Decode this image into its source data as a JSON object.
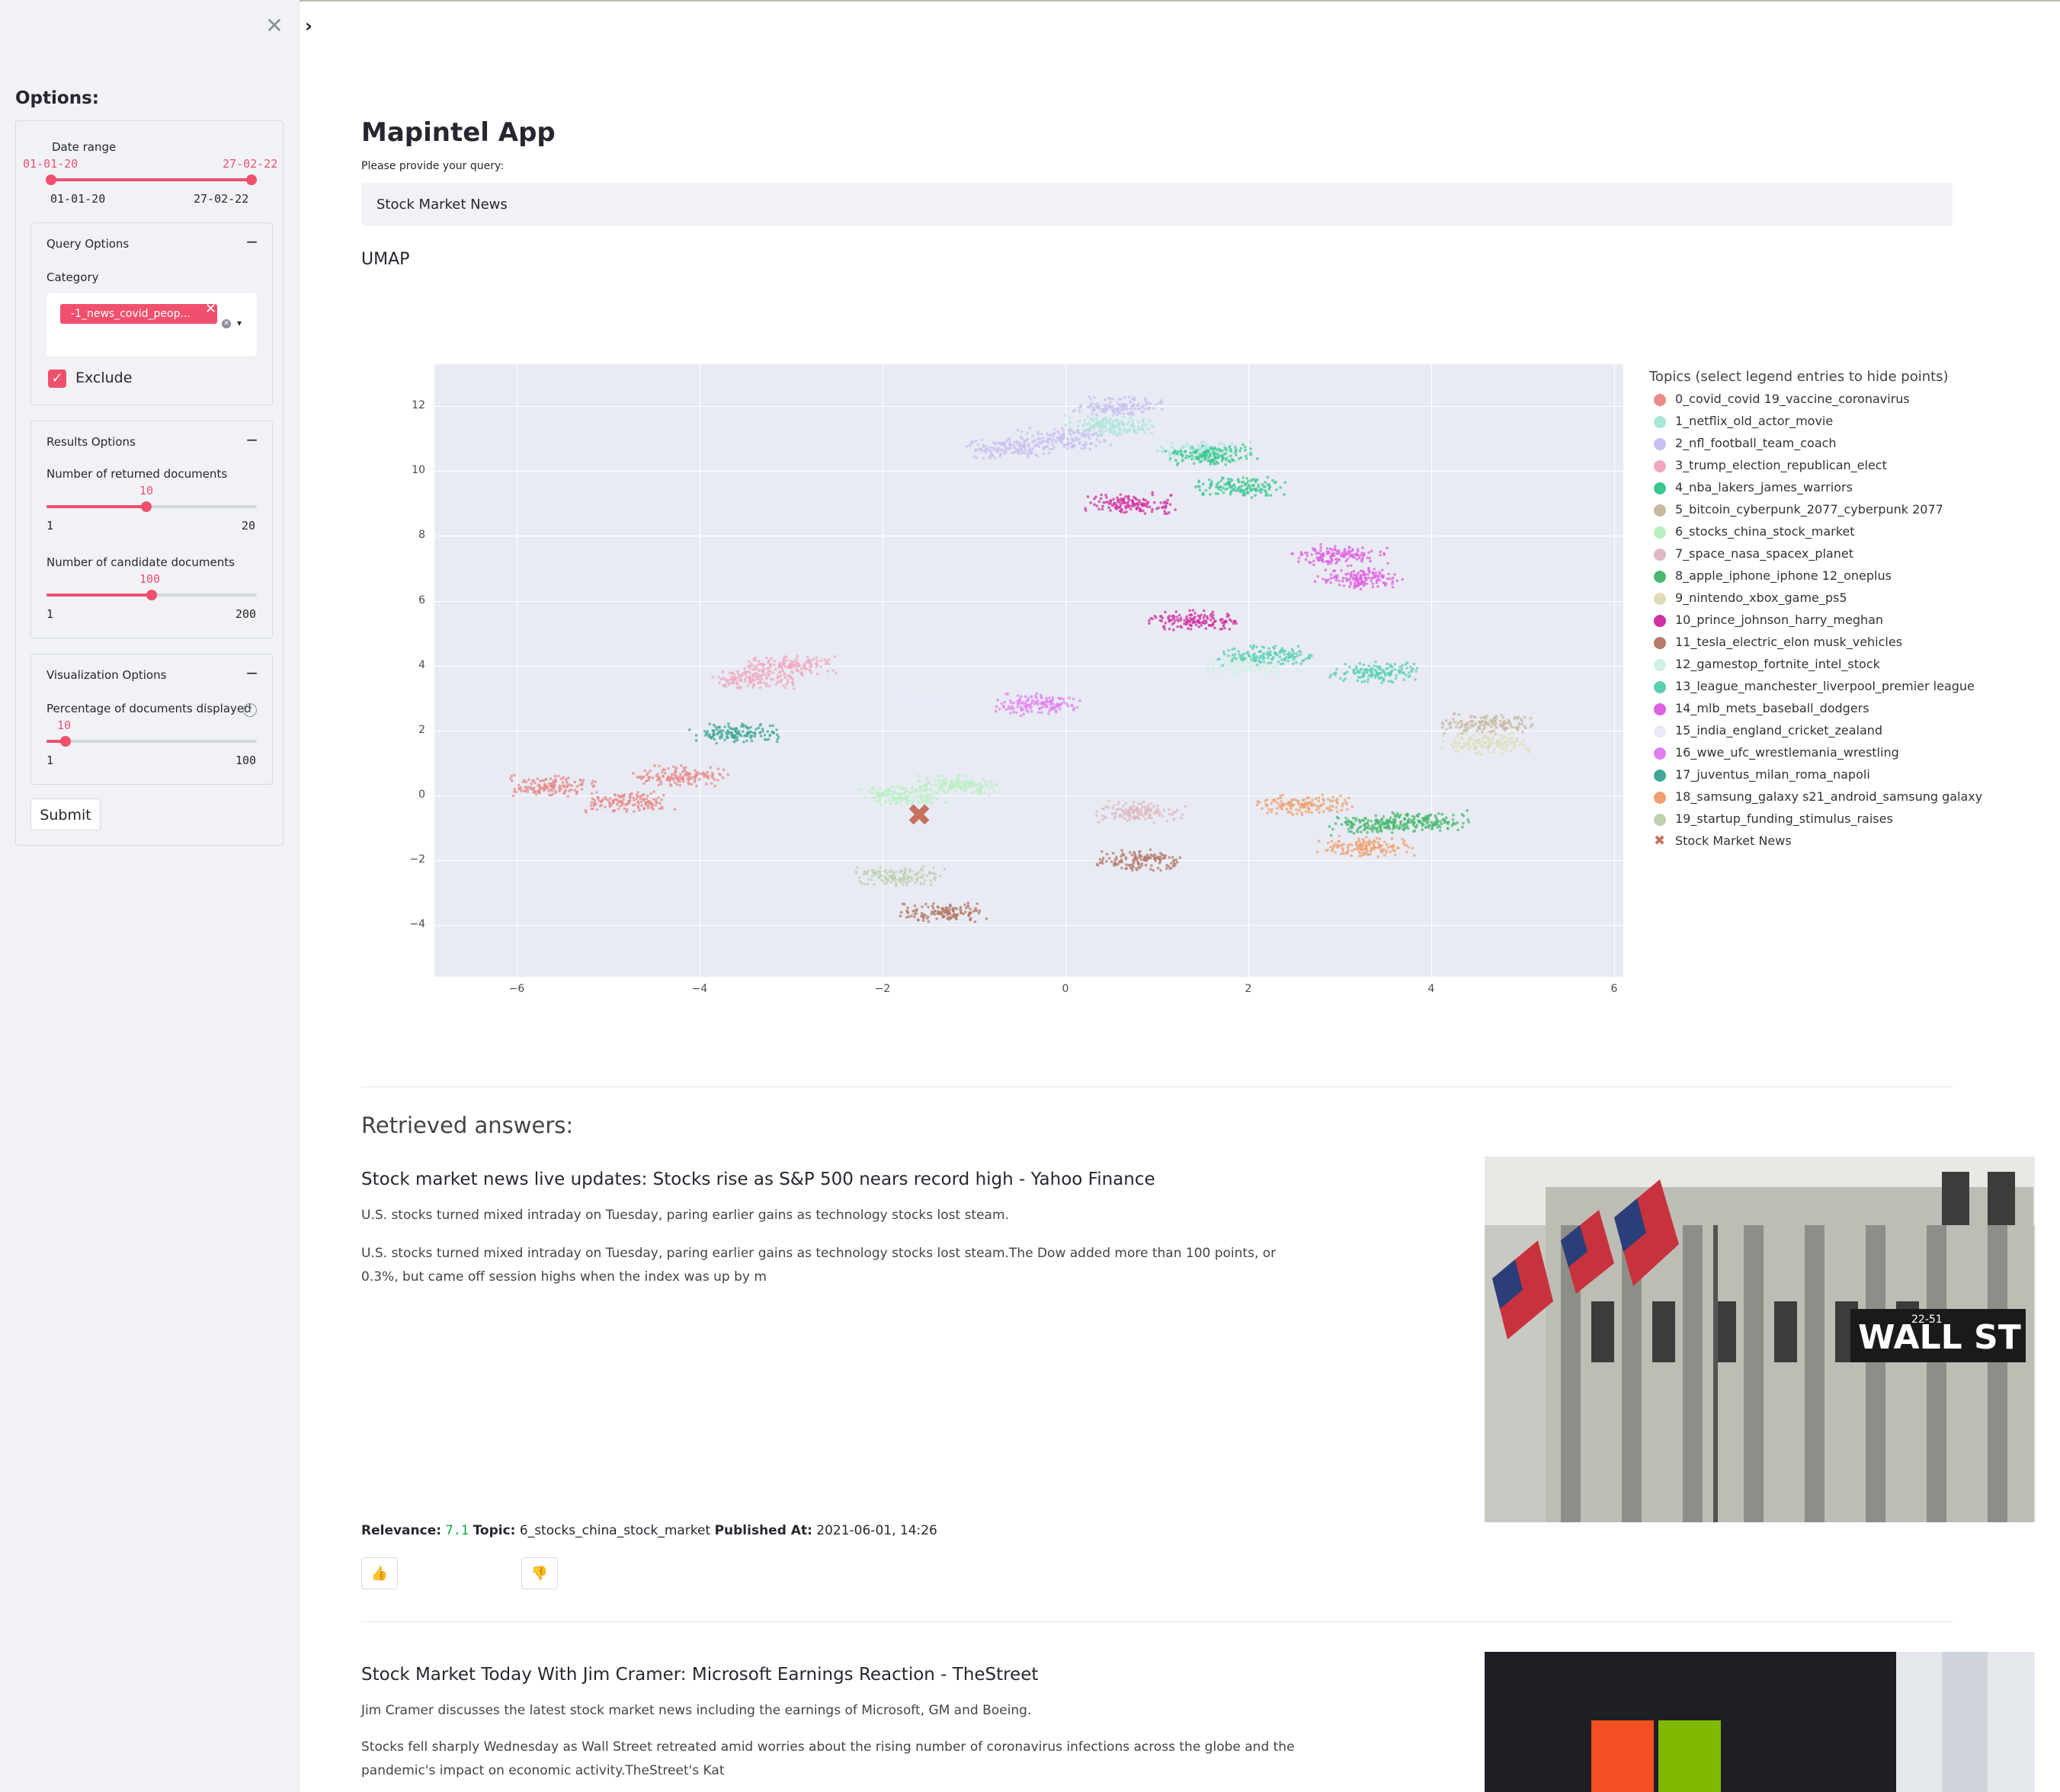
{
  "sidebar": {
    "title": "Options:",
    "date_range": {
      "label": "Date range",
      "start": "01-01-20",
      "end": "27-02-22",
      "min": "01-01-20",
      "max": "27-02-22"
    },
    "query_options": {
      "title": "Query Options",
      "toggle": "−",
      "category_label": "Category",
      "selected_tag": "-1_news_covid_peop...",
      "exclude_label": "Exclude",
      "exclude_checked": true
    },
    "results_options": {
      "title": "Results Options",
      "toggle": "−",
      "returned": {
        "label": "Number of returned documents",
        "value": "10",
        "min": "1",
        "max": "20"
      },
      "candidate": {
        "label": "Number of candidate documents",
        "value": "100",
        "min": "1",
        "max": "200"
      }
    },
    "visualization_options": {
      "title": "Visualization Options",
      "toggle": "−",
      "percentage": {
        "label": "Percentage of documents displayed",
        "value": "10",
        "min": "1",
        "max": "100"
      }
    },
    "submit_label": "Submit"
  },
  "main": {
    "title": "Mapintel App",
    "query_label": "Please provide your query:",
    "query_value": "Stock Market News",
    "umap_title": "UMAP",
    "retrieved_title": "Retrieved answers:"
  },
  "chart_data": {
    "type": "scatter",
    "title": "",
    "xlabel": "",
    "ylabel": "",
    "xlim": [
      -6.9,
      6.1
    ],
    "ylim": [
      -5.6,
      13.3
    ],
    "x_ticks": [
      "−6",
      "−4",
      "−2",
      "0",
      "2",
      "4",
      "6"
    ],
    "y_ticks": [
      "12",
      "10",
      "8",
      "6",
      "4",
      "2",
      "0",
      "−2",
      "−4"
    ],
    "legend_title": "Topics (select legend entries to hide points)",
    "legend_placement": "right",
    "series": [
      {
        "name": "0_covid_covid 19_vaccine_coronavirus",
        "color": "#e88a8a",
        "centers": [
          [
            -5.6,
            0.3
          ],
          [
            -4.8,
            -0.2
          ],
          [
            -4.2,
            0.6
          ]
        ]
      },
      {
        "name": "1_netflix_old_actor_movie",
        "color": "#a8e6d8",
        "centers": [
          [
            0.5,
            11.4
          ],
          [
            1.5,
            10.6
          ]
        ]
      },
      {
        "name": "2_nfl_football_team_coach",
        "color": "#c8c0f0",
        "centers": [
          [
            0.0,
            11.0
          ],
          [
            -0.6,
            10.7
          ],
          [
            0.6,
            12.0
          ]
        ]
      },
      {
        "name": "3_trump_election_republican_elect",
        "color": "#f0a8c0",
        "centers": [
          [
            -3.4,
            3.6
          ],
          [
            -3.0,
            4.0
          ]
        ]
      },
      {
        "name": "4_nba_lakers_james_warriors",
        "color": "#3cc890",
        "centers": [
          [
            1.6,
            10.5
          ],
          [
            1.9,
            9.5
          ]
        ]
      },
      {
        "name": "5_bitcoin_cyberpunk_2077_cyberpunk 2077",
        "color": "#c8b8a0",
        "centers": [
          [
            4.6,
            2.2
          ]
        ]
      },
      {
        "name": "6_stocks_china_stock_market",
        "color": "#b8f0c0",
        "centers": [
          [
            -1.8,
            0.0
          ],
          [
            -1.2,
            0.3
          ]
        ]
      },
      {
        "name": "7_space_nasa_spacex_planet",
        "color": "#e0b8c0",
        "centers": [
          [
            0.8,
            -0.5
          ]
        ]
      },
      {
        "name": "8_apple_iphone_iphone 12_oneplus",
        "color": "#4ab870",
        "centers": [
          [
            3.4,
            -0.9
          ],
          [
            3.9,
            -0.8
          ]
        ]
      },
      {
        "name": "9_nintendo_xbox_game_ps5",
        "color": "#e0dcb8",
        "centers": [
          [
            4.6,
            1.6
          ]
        ]
      },
      {
        "name": "10_prince_johnson_harry_meghan",
        "color": "#d030a0",
        "centers": [
          [
            1.4,
            5.4
          ],
          [
            0.7,
            9.0
          ]
        ]
      },
      {
        "name": "11_tesla_electric_elon musk_vehicles",
        "color": "#b47a6a",
        "centers": [
          [
            0.8,
            -2.0
          ],
          [
            -1.3,
            -3.6
          ]
        ]
      },
      {
        "name": "12_gamestop_fortnite_intel_stock",
        "color": "#d0f0e8",
        "centers": [
          [
            2.0,
            4.0
          ]
        ]
      },
      {
        "name": "13_league_manchester_liverpool_premier league",
        "color": "#5ad0b0",
        "centers": [
          [
            2.2,
            4.3
          ],
          [
            3.4,
            3.8
          ]
        ]
      },
      {
        "name": "14_mlb_mets_baseball_dodgers",
        "color": "#e060e0",
        "centers": [
          [
            3.0,
            7.4
          ],
          [
            3.2,
            6.7
          ]
        ]
      },
      {
        "name": "15_india_england_cricket_zealand",
        "color": "#e8eaf8",
        "centers": [
          [
            -1.5,
            3.0
          ]
        ]
      },
      {
        "name": "16_wwe_ufc_wrestlemania_wrestling",
        "color": "#e080f0",
        "centers": [
          [
            -0.3,
            2.8
          ]
        ]
      },
      {
        "name": "17_juventus_milan_roma_napoli",
        "color": "#40a898",
        "centers": [
          [
            -3.6,
            1.9
          ]
        ]
      },
      {
        "name": "18_samsung_galaxy s21_android_samsung galaxy",
        "color": "#f0a070",
        "centers": [
          [
            2.6,
            -0.3
          ],
          [
            3.3,
            -1.6
          ]
        ]
      },
      {
        "name": "19_startup_funding_stimulus_raises",
        "color": "#c0d0b0",
        "centers": [
          [
            -1.8,
            -2.5
          ]
        ]
      },
      {
        "name": "Stock Market News",
        "color": "#c87060",
        "marker": "x",
        "points": [
          [
            -1.6,
            -0.6
          ]
        ]
      }
    ]
  },
  "articles": [
    {
      "title": "Stock market news live updates: Stocks rise as S&P 500 nears record high - Yahoo Finance",
      "summary": "U.S. stocks turned mixed intraday on Tuesday, paring earlier gains as technology stocks lost steam.",
      "body": "U.S. stocks turned mixed intraday on Tuesday, paring earlier gains as technology stocks lost steam.The Dow added more than 100 points, or 0.3%, but came off session highs when the index was up by m",
      "relevance_label": "Relevance:",
      "relevance": "7.1",
      "topic_label": "Topic:",
      "topic": "6_stocks_china_stock_market",
      "published_label": "Published At:",
      "published": "2021-06-01, 14:26",
      "image_text": "WALL ST",
      "image_subtext": "22-51"
    },
    {
      "title": "Stock Market Today With Jim Cramer: Microsoft Earnings Reaction - TheStreet",
      "summary": "Jim Cramer discusses the latest stock market news including the earnings of Microsoft, GM and Boeing.",
      "body": "Stocks fell sharply Wednesday as Wall Street retreated amid worries about the rising number of coronavirus infections across the globe and the pandemic's impact on economic activity.TheStreet's Kat"
    }
  ],
  "icons": {
    "close": "close-icon",
    "expand": "chevron-right-icon",
    "thumbs_up": "thumbs-up-icon",
    "thumbs_down": "thumbs-down-icon",
    "help": "help-icon"
  },
  "colors": {
    "accent": "#f0506e",
    "sidebar_bg": "#f0f2f6",
    "relevance": "#09ab3b",
    "plot_bg": "#e8ebf3"
  }
}
